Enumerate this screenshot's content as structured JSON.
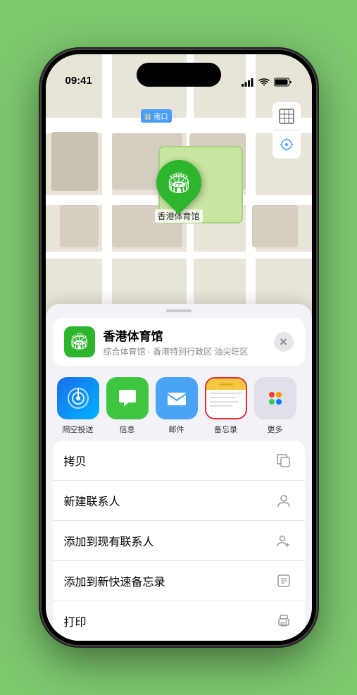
{
  "status_bar": {
    "time": "09:41",
    "location_arrow": "▶"
  },
  "map": {
    "label": "南口",
    "controls": {
      "map_icon": "🗺",
      "location_icon": "➤"
    }
  },
  "pin": {
    "label": "香港体育馆"
  },
  "place_card": {
    "name": "香港体育馆",
    "subtitle": "综合体育馆 · 香港特别行政区 油尖旺区",
    "close_label": "✕"
  },
  "share_apps": [
    {
      "id": "airdrop",
      "label": "隔空投送",
      "type": "airdrop"
    },
    {
      "id": "messages",
      "label": "信息",
      "type": "messages"
    },
    {
      "id": "mail",
      "label": "邮件",
      "type": "mail"
    },
    {
      "id": "notes",
      "label": "备忘录",
      "type": "notes"
    },
    {
      "id": "more",
      "label": "更多",
      "type": "more"
    }
  ],
  "actions": [
    {
      "id": "copy",
      "label": "拷贝",
      "icon": "copy"
    },
    {
      "id": "new-contact",
      "label": "新建联系人",
      "icon": "person"
    },
    {
      "id": "add-existing",
      "label": "添加到现有联系人",
      "icon": "person-add"
    },
    {
      "id": "add-note",
      "label": "添加到新快速备忘录",
      "icon": "note"
    },
    {
      "id": "print",
      "label": "打印",
      "icon": "print"
    }
  ],
  "colors": {
    "green": "#2db52d",
    "blue": "#4ba3f5",
    "red": "#e03030",
    "yellow": "#f5c842"
  }
}
